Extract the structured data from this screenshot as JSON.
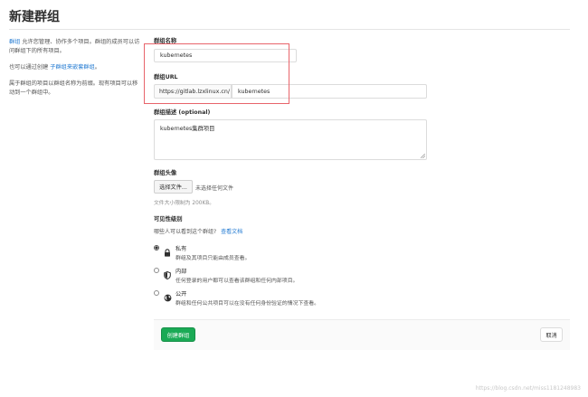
{
  "page": {
    "title": "新建群组"
  },
  "sidebar": {
    "intro_link": "群组",
    "intro_text": "允许您管理、协作多个项目。群组的成员可以访问群组下的所有项目。",
    "nested_prefix": "也可以通过创建",
    "nested_link": "子群组来嵌套群组",
    "nested_suffix": "。",
    "namespace_text": "属于群组的项目以群组名称为前缀。现有项目可以移动到一个群组中。"
  },
  "form": {
    "group_name": {
      "label": "群组名称",
      "value": "kubernetes"
    },
    "group_url": {
      "label": "群组URL",
      "prefix": "https://gitlab.lzxlinux.cn/",
      "value": "kubernetes"
    },
    "description": {
      "label": "群组描述 (optional)",
      "value": "kubernetes集群项目"
    },
    "avatar": {
      "label": "群组头像",
      "choose_button": "选择文件...",
      "no_file_text": "未选择任何文件",
      "size_hint": "文件大小限制为 200KB。"
    },
    "visibility": {
      "label": "可见性级别",
      "question": "哪些人可以看到这个群组?",
      "help_link": "查看文档",
      "options": [
        {
          "title": "私有",
          "desc": "群组及其项目只能由成员查看。",
          "icon": "lock-icon",
          "selected": true
        },
        {
          "title": "内部",
          "desc": "任何登录的用户都可以查看该群组和任何内部项目。",
          "icon": "shield-icon",
          "selected": false
        },
        {
          "title": "公开",
          "desc": "群组和任何公共项目可以在没有任何身份验证的情况下查看。",
          "icon": "globe-icon",
          "selected": false
        }
      ]
    }
  },
  "actions": {
    "create_label": "创建群组",
    "cancel_label": "取消"
  },
  "watermark": "https://blog.csdn.net/miss1181248983",
  "colors": {
    "accent": "#1f78d1",
    "create_button": "#1aaa55",
    "highlight_box": "#e8646b"
  }
}
